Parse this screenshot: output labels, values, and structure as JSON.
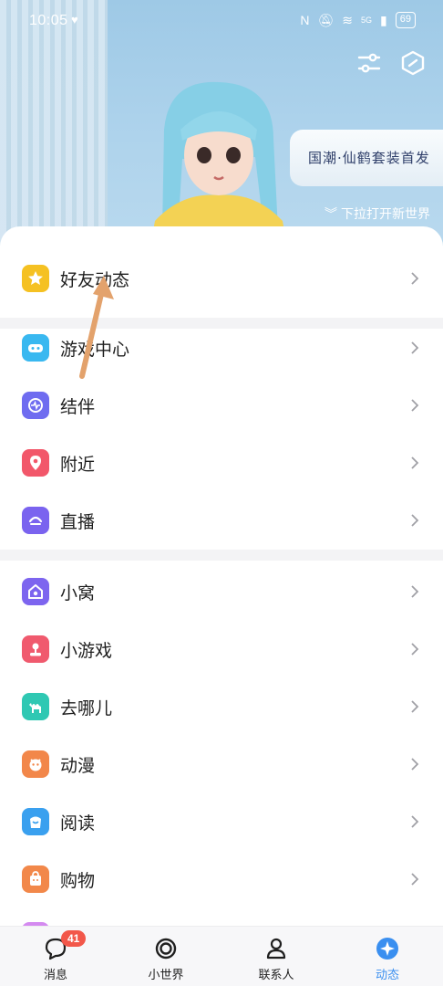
{
  "status_bar": {
    "time": "10:05",
    "battery": "69",
    "network": "5G"
  },
  "hero": {
    "promo_text": "国潮·仙鹤套装首发",
    "pull_hint": "下拉打开新世界",
    "icons": [
      "sliders-icon",
      "hexagon-icon"
    ]
  },
  "menu": {
    "group1": [
      {
        "label": "好友动态",
        "icon": "star-icon",
        "color": "#f5c122"
      }
    ],
    "group2": [
      {
        "label": "游戏中心",
        "icon": "gamepad-icon",
        "color": "#39b8f0"
      },
      {
        "label": "结伴",
        "icon": "chat-wave-icon",
        "color": "#6f6cf0"
      },
      {
        "label": "附近",
        "icon": "location-pin-icon",
        "color": "#f2576a"
      },
      {
        "label": "直播",
        "icon": "live-icon",
        "color": "#7a63ef"
      }
    ],
    "group3": [
      {
        "label": "小窝",
        "icon": "home-icon",
        "color": "#7d65ef"
      },
      {
        "label": "小游戏",
        "icon": "joystick-icon",
        "color": "#f05a6e"
      },
      {
        "label": "去哪儿",
        "icon": "camel-icon",
        "color": "#2fc8b3"
      },
      {
        "label": "动漫",
        "icon": "cartoon-face-icon",
        "color": "#f2874a"
      },
      {
        "label": "阅读",
        "icon": "book-bag-icon",
        "color": "#3aa0ef"
      },
      {
        "label": "购物",
        "icon": "shopping-icon",
        "color": "#f2884a"
      }
    ]
  },
  "tabs": [
    {
      "label": "消息",
      "icon": "message-icon",
      "badge": "41"
    },
    {
      "label": "小世界",
      "icon": "world-icon"
    },
    {
      "label": "联系人",
      "icon": "contacts-icon"
    },
    {
      "label": "动态",
      "icon": "star-dynamic-icon",
      "active": true
    }
  ],
  "colors": {
    "accent": "#3a8ff0",
    "badge": "#f2574a",
    "arrow": "#e3a26c"
  }
}
